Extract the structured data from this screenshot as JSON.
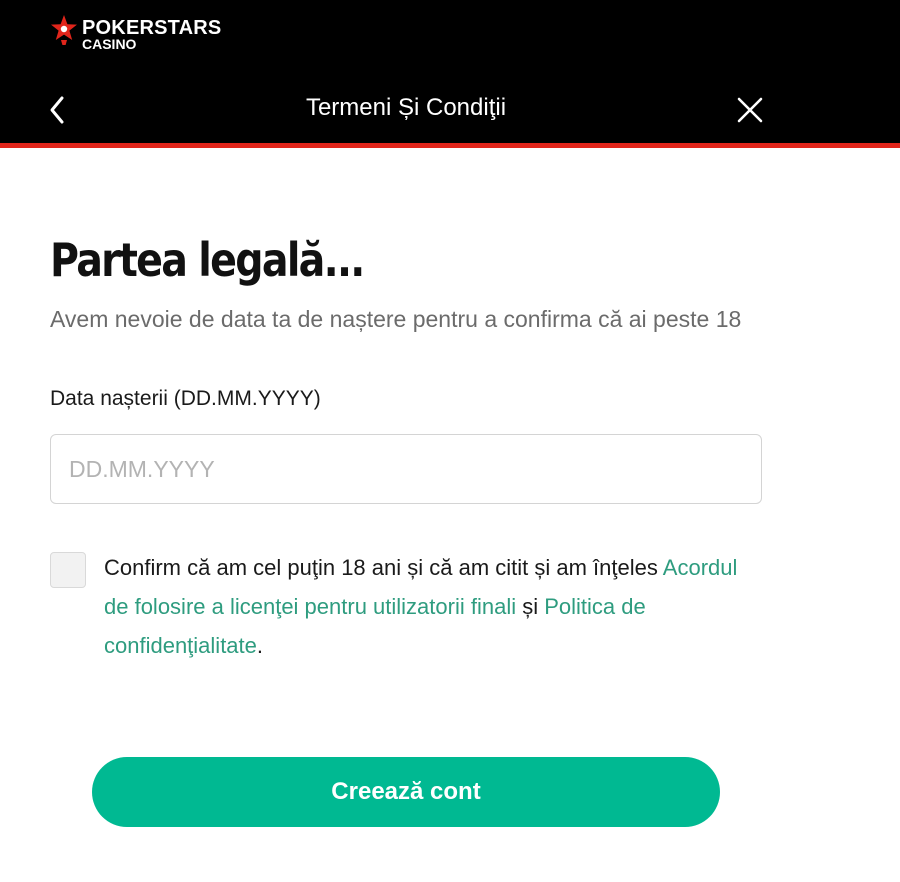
{
  "brand": {
    "name": "POKERSTARS",
    "sub": "CASINO",
    "star_color": "#e1251b"
  },
  "nav": {
    "title": "Termeni Și Condiţii",
    "back_icon": "chevron-left-icon",
    "close_icon": "close-icon"
  },
  "main": {
    "title": "Partea legală...",
    "subtitle": "Avem nevoie de data ta de naștere pentru a confirma că ai peste 18",
    "dob_label": "Data nașterii (DD.MM.YYYY)",
    "dob_placeholder": "DD.MM.YYYY",
    "dob_value": ""
  },
  "consent": {
    "checked": false,
    "text_before": "Confirm că am cel puţin 18 ani și că am citit și am înţeles ",
    "eula_link": "Acordul de folosire a licenţei pentru utilizatorii finali",
    "text_middle": " și ",
    "privacy_link": "Politica de confidenţialitate",
    "text_after": "."
  },
  "actions": {
    "create_label": "Creează cont"
  },
  "colors": {
    "header_bg": "#000000",
    "accent_red": "#e1251b",
    "primary_green": "#00b992",
    "link_green": "#2e9c7f"
  }
}
